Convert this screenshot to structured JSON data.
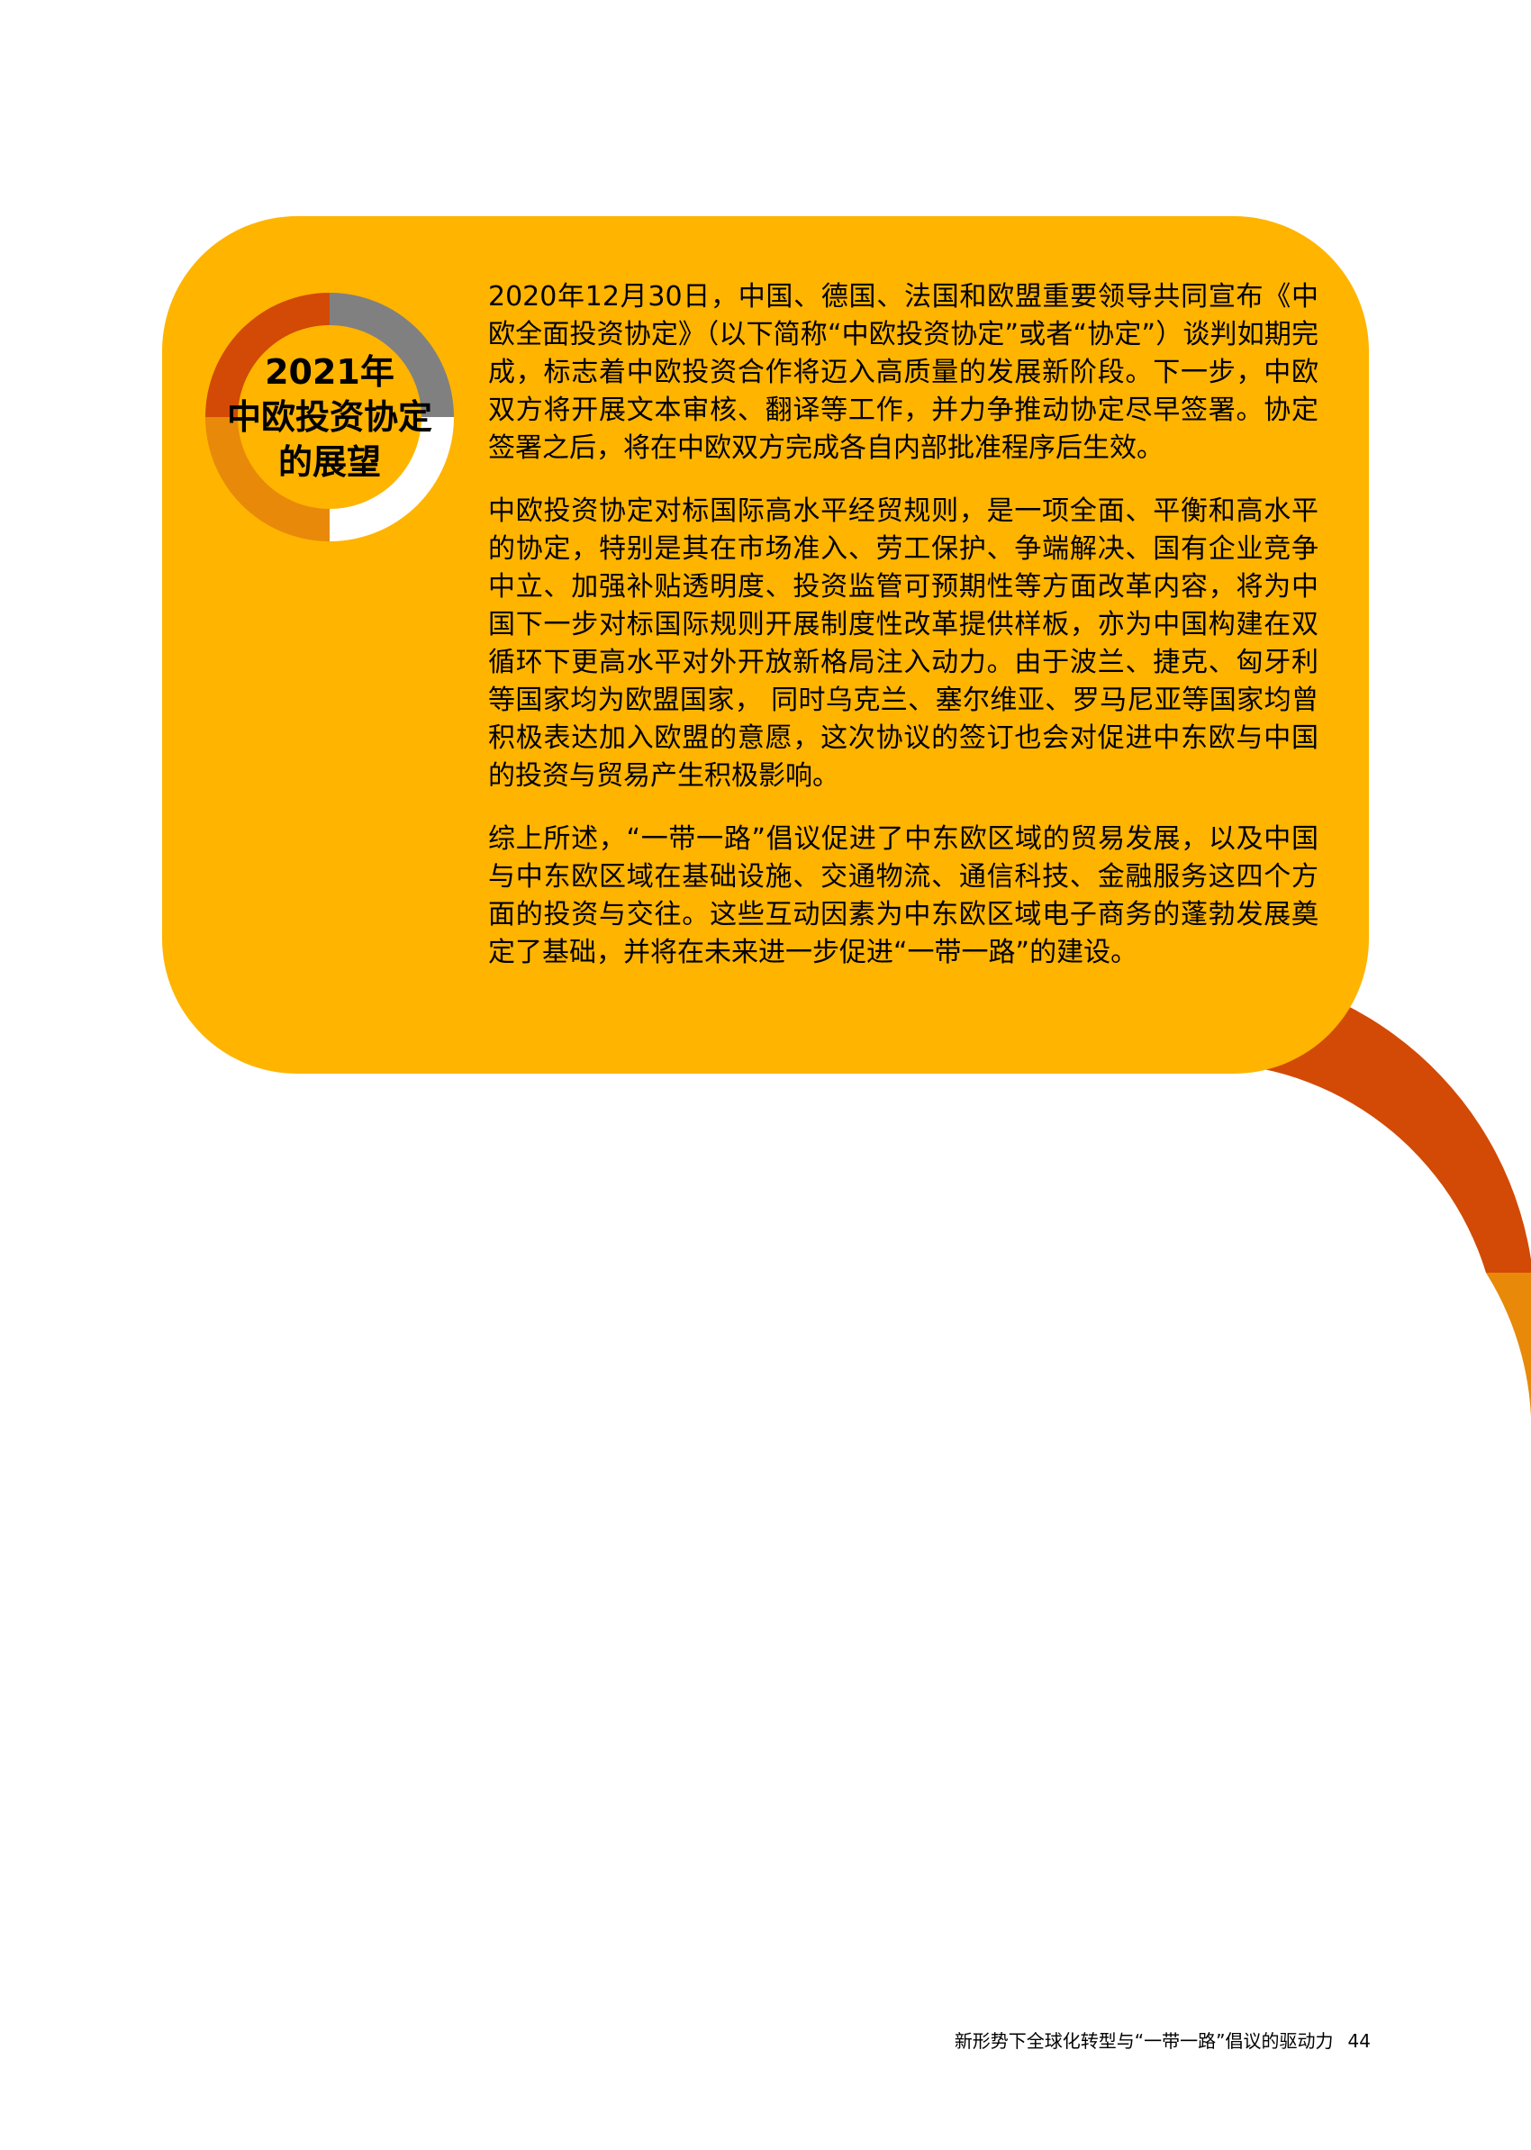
{
  "colors": {
    "callout_bg": "#FFB400",
    "donut_segments": [
      "#808080",
      "#FFFFFF",
      "#E8890A",
      "#D24A06"
    ],
    "deco_arc_outer": "#D24A06",
    "deco_arc_inner": "#E8890A"
  },
  "callout": {
    "title_lines": [
      "2021年",
      "中欧投资协定",
      "的展望"
    ],
    "paragraphs": [
      "2020年12月30日，中国、德国、法国和欧盟重要领导共同宣布《中欧全面投资协定》（以下简称“中欧投资协定”或者“协定”）谈判如期完成，标志着中欧投资合作将迈入高质量的发展新阶段。下一步，中欧双方将开展文本审核、翻译等工作，并力争推动协定尽早签署。协定签署之后，将在中欧双方完成各自内部批准程序后生效。",
      "中欧投资协定对标国际高水平经贸规则，是一项全面、平衡和高水平的协定，特别是其在市场准入、劳工保护、争端解决、国有企业竞争中立、加强补贴透明度、投资监管可预期性等方面改革内容，将为中国下一步对标国际规则开展制度性改革提供样板，亦为中国构建在双循环下更高水平对外开放新格局注入动力。由于波兰、捷克、匈牙利等国家均为欧盟国家， 同时乌克兰、塞尔维亚、罗马尼亚等国家均曾积极表达加入欧盟的意愿，这次协议的签订也会对促进中东欧与中国的投资与贸易产生积极影响。",
      "综上所述，“一带一路”倡议促进了中东欧区域的贸易发展，以及中国与中东欧区域在基础设施、交通物流、通信科技、金融服务这四个方面的投资与交往。这些互动因素为中东欧区域电子商务的蓬勃发展奠定了基础，并将在未来进一步促进“一带一路”的建设。"
    ]
  },
  "footer": {
    "running_title": "新形势下全球化转型与“一带一路”倡议的驱动力",
    "page_number": "44"
  }
}
